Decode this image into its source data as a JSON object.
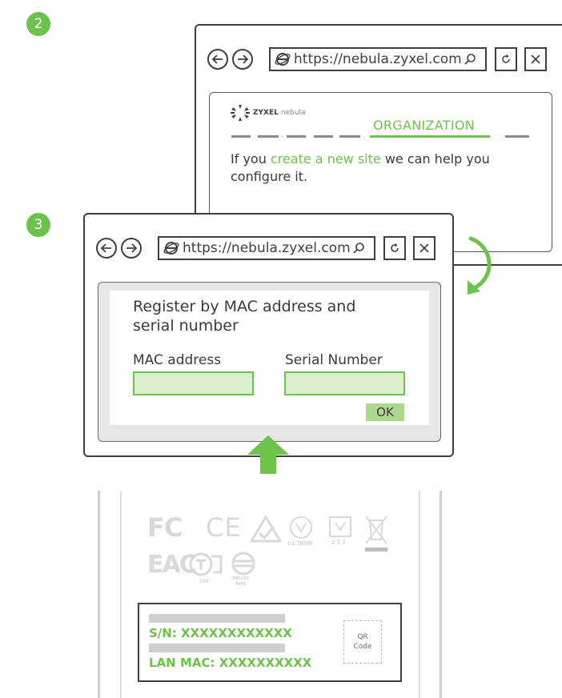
{
  "steps": {
    "step2": "2",
    "step3": "3"
  },
  "browser_back": {
    "url": "https://nebula.zyxel.com"
  },
  "browser_front": {
    "url": "https://nebula.zyxel.com"
  },
  "nebula_page": {
    "brand": "ZYXEL",
    "product": "nebula",
    "stage": "ORGANIZATION",
    "text_before": "If you ",
    "link_text": "create a new site",
    "text_after": " we can help you configure it."
  },
  "register_form": {
    "title": "Register by MAC address and serial number",
    "mac_label": "MAC address",
    "mac_value": "",
    "serial_label": "Serial Number",
    "serial_value": "",
    "ok_label": "OK"
  },
  "device_label": {
    "sn_text": "S/N: XXXXXXXXXXXX",
    "mac_text": "LAN MAC: XXXXXXXXXX",
    "qr_line1": "QR",
    "qr_line2": "Code"
  },
  "cert_marks": {
    "fc": "FC",
    "ce": "CE",
    "eac": "EAC",
    "ua_code": "UA.TR008",
    "code_153": "153",
    "code_030": "030",
    "d_code": "D41163",
    "rohs": "RoHS"
  },
  "colors": {
    "accent": "#6cc24a",
    "field_fill": "#dbefcf",
    "frame": "#3f3f3f",
    "panel_gray": "#e6e6e6"
  }
}
